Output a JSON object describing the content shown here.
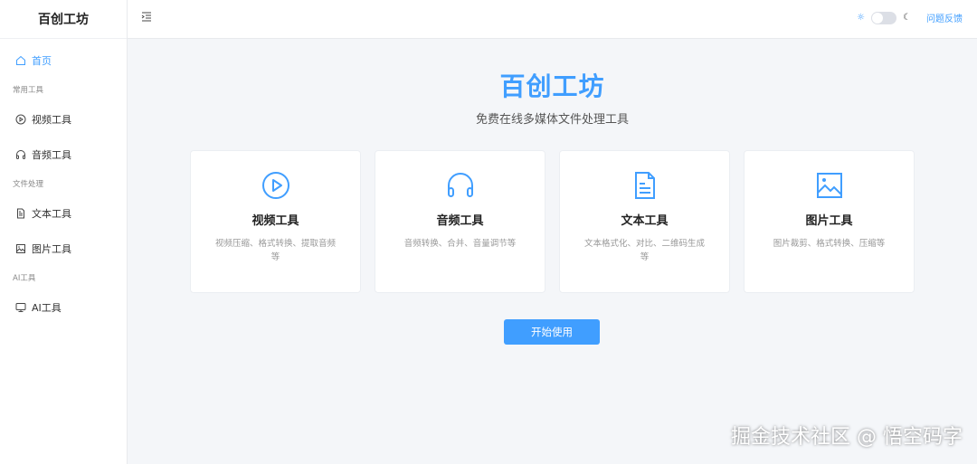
{
  "app": {
    "title": "百创工坊"
  },
  "sidebar": {
    "home": "首页",
    "groups": [
      {
        "label": "常用工具",
        "items": [
          {
            "label": "视频工具",
            "icon": "play-circle-icon"
          },
          {
            "label": "音频工具",
            "icon": "headphones-icon"
          }
        ]
      },
      {
        "label": "文件处理",
        "items": [
          {
            "label": "文本工具",
            "icon": "document-icon"
          },
          {
            "label": "图片工具",
            "icon": "image-icon"
          }
        ]
      },
      {
        "label": "AI工具",
        "items": [
          {
            "label": "AI工具",
            "icon": "monitor-icon"
          }
        ]
      }
    ]
  },
  "header": {
    "feedback": "问题反馈",
    "theme_dark": false
  },
  "main": {
    "title": "百创工坊",
    "subtitle": "免费在线多媒体文件处理工具",
    "cards": [
      {
        "title": "视频工具",
        "desc": "视频压缩、格式转换、提取音频等"
      },
      {
        "title": "音频工具",
        "desc": "音频转换、合并、音量调节等"
      },
      {
        "title": "文本工具",
        "desc": "文本格式化、对比、二维码生成等"
      },
      {
        "title": "图片工具",
        "desc": "图片裁剪、格式转换、压缩等"
      }
    ],
    "start_button": "开始使用"
  },
  "watermark": "掘金技术社区 @ 悟空码字",
  "colors": {
    "accent": "#409eff",
    "background": "#f4f6f9"
  }
}
